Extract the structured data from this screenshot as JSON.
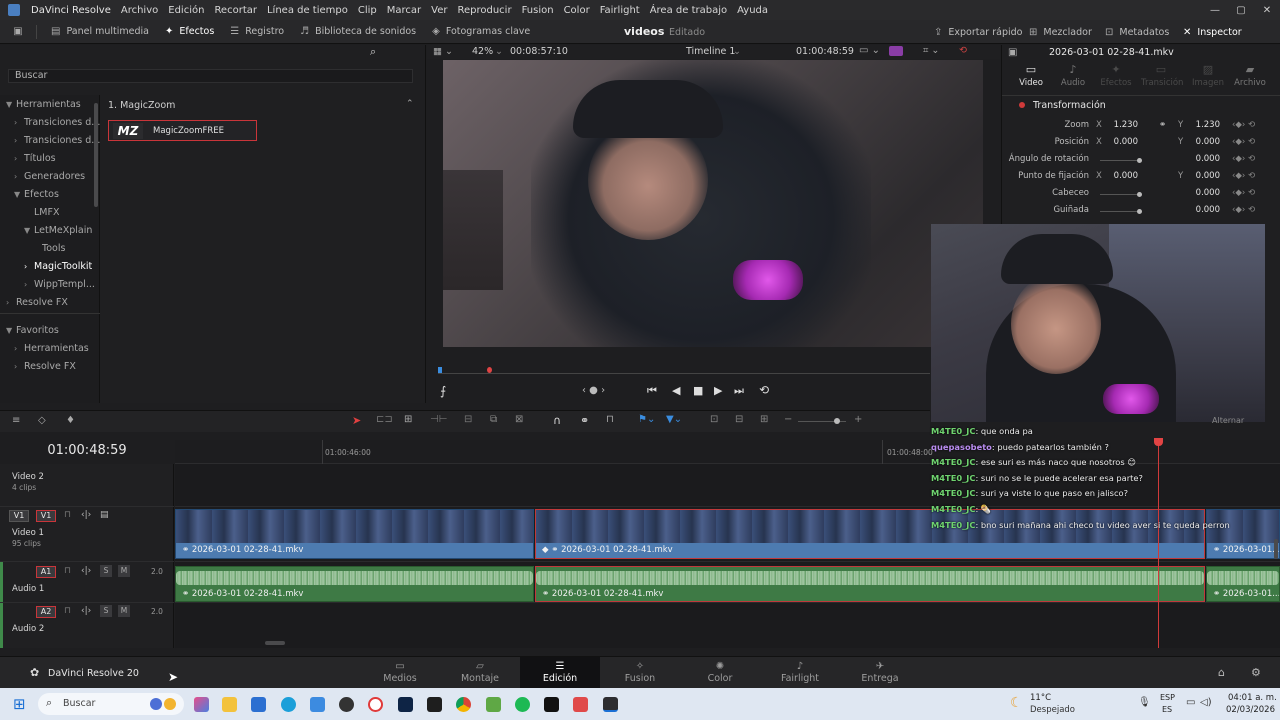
{
  "app": {
    "title": "DaVinci Resolve",
    "menu": [
      "Archivo",
      "Edición",
      "Recortar",
      "Línea de tiempo",
      "Clip",
      "Marcar",
      "Ver",
      "Reproducir",
      "Fusion",
      "Color",
      "Fairlight",
      "Área de trabajo",
      "Ayuda"
    ],
    "window_controls": {
      "minimize": "—",
      "maximize": "▢",
      "close": "✕"
    }
  },
  "toolbar": {
    "left": [
      {
        "label": "Panel multimedia",
        "icon": "media-pool-icon"
      },
      {
        "label": "Efectos",
        "icon": "effects-wand-icon",
        "active": true
      },
      {
        "label": "Registro",
        "icon": "list-icon"
      },
      {
        "label": "Biblioteca de sonidos",
        "icon": "sound-library-icon"
      },
      {
        "label": "Fotogramas clave",
        "icon": "keyframes-icon"
      }
    ],
    "project_name": "videos",
    "project_status": "Editado",
    "right": [
      {
        "label": "Exportar rápido",
        "icon": "export-icon"
      },
      {
        "label": "Mezclador",
        "icon": "mixer-icon"
      },
      {
        "label": "Metadatos",
        "icon": "metadata-icon"
      },
      {
        "label": "Inspector",
        "icon": "inspector-icon",
        "active": true
      }
    ]
  },
  "effects_panel": {
    "search_placeholder": "Buscar",
    "tree": [
      {
        "label": "Herramientas",
        "level": 0,
        "expanded": true
      },
      {
        "label": "Transiciones d...",
        "level": 1
      },
      {
        "label": "Transiciones d...",
        "level": 1
      },
      {
        "label": "Títulos",
        "level": 1
      },
      {
        "label": "Generadores",
        "level": 1
      },
      {
        "label": "Efectos",
        "level": 1,
        "expanded": true
      },
      {
        "label": "LMFX",
        "level": 2
      },
      {
        "label": "LetMeXplain",
        "level": 2,
        "expanded": true
      },
      {
        "label": "Tools",
        "level": 3
      },
      {
        "label": "MagicToolkit",
        "level": 2,
        "selected": true
      },
      {
        "label": "WippTempl...",
        "level": 2
      },
      {
        "label": "Resolve FX",
        "level": 1,
        "expanded": true
      }
    ],
    "favorites_header": "Favoritos",
    "favorites": [
      {
        "label": "Herramientas",
        "level": 1
      },
      {
        "label": "Resolve FX",
        "level": 1
      }
    ],
    "group_title": "1. MagicZoom",
    "effect_item": {
      "logo_text": "MZ",
      "label": "MagicZoomFREE"
    }
  },
  "viewer": {
    "zoom": "42%",
    "duration": "00:08:57:10",
    "timeline_name": "Timeline 1",
    "timecode": "01:00:48:59"
  },
  "inspector": {
    "clip_name": "2026-03-01 02-28-41.mkv",
    "tabs": [
      "Video",
      "Audio",
      "Efectos",
      "Transición",
      "Imagen",
      "Archivo"
    ],
    "active_tab": "Video",
    "section": "Transformación",
    "rows": [
      {
        "label": "Zoom",
        "x_label": "X",
        "x": "1.230",
        "y_label": "Y",
        "y": "1.230"
      },
      {
        "label": "Posición",
        "x_label": "X",
        "x": "0.000",
        "y_label": "Y",
        "y": "0.000"
      },
      {
        "label": "Ángulo de rotación",
        "value": "0.000"
      },
      {
        "label": "Punto de fijación",
        "x_label": "X",
        "x": "0.000",
        "y_label": "Y",
        "y": "0.000"
      },
      {
        "label": "Cabeceo",
        "value": "0.000"
      },
      {
        "label": "Guiñada",
        "value": "0.000"
      }
    ]
  },
  "timeline": {
    "timecode": "01:00:48:59",
    "ruler_labels": [
      "01:00:46:00",
      "01:00:48:00"
    ],
    "tracks": [
      {
        "id": "V2",
        "name": "Video 2",
        "clips": "4 clips"
      },
      {
        "id": "V1",
        "name": "Video 1",
        "clips": "95 clips"
      },
      {
        "id": "A1",
        "name": "Audio 1",
        "level": "2.0"
      },
      {
        "id": "A2",
        "name": "Audio 2",
        "level": "2.0"
      }
    ],
    "video_clips": [
      "2026-03-01 02-28-41.mkv",
      "2026-03-01 02-28-41.mkv",
      "2026-03-01..."
    ],
    "audio_clips": [
      "2026-03-01 02-28-41.mkv",
      "2026-03-01 02-28-41.mkv",
      "2026-03-01..."
    ],
    "right_tag": "Alternar"
  },
  "chat": [
    {
      "user": "M4TE0_JC",
      "color": "#6fd36f",
      "text": ": que onda pa"
    },
    {
      "user": "quepasobeto",
      "color": "#b98cf0",
      "text": ": puedo patearlos también ?"
    },
    {
      "user": "M4TE0_JC",
      "color": "#6fd36f",
      "text": ": ese suri es más naco que nosotros 😊"
    },
    {
      "user": "M4TE0_JC",
      "color": "#6fd36f",
      "text": ": suri no se le puede acelerar esa parte?"
    },
    {
      "user": "M4TE0_JC",
      "color": "#6fd36f",
      "text": ": suri ya viste lo que paso en jalisco?"
    },
    {
      "user": "M4TE0_JC",
      "color": "#6fd36f",
      "text": ": 🌯"
    },
    {
      "user": "M4TE0_JC",
      "color": "#6fd36f",
      "text": ": bno suri mañana ahi checo tu video aver si te queda perron"
    }
  ],
  "pages": {
    "brand": "DaVinci Resolve 20",
    "items": [
      {
        "label": "Medios",
        "icon": "media-page-icon"
      },
      {
        "label": "Montaje",
        "icon": "cut-page-icon"
      },
      {
        "label": "Edición",
        "icon": "edit-page-icon",
        "active": true
      },
      {
        "label": "Fusion",
        "icon": "fusion-page-icon"
      },
      {
        "label": "Color",
        "icon": "color-page-icon"
      },
      {
        "label": "Fairlight",
        "icon": "fairlight-page-icon"
      },
      {
        "label": "Entrega",
        "icon": "deliver-page-icon"
      }
    ]
  },
  "taskbar": {
    "search_placeholder": "Buscar",
    "weather_temp": "11°C",
    "weather_desc": "Despejado",
    "lang_top": "ESP",
    "lang_bottom": "ES",
    "time": "04:01 a. m.",
    "date": "02/03/2026"
  }
}
